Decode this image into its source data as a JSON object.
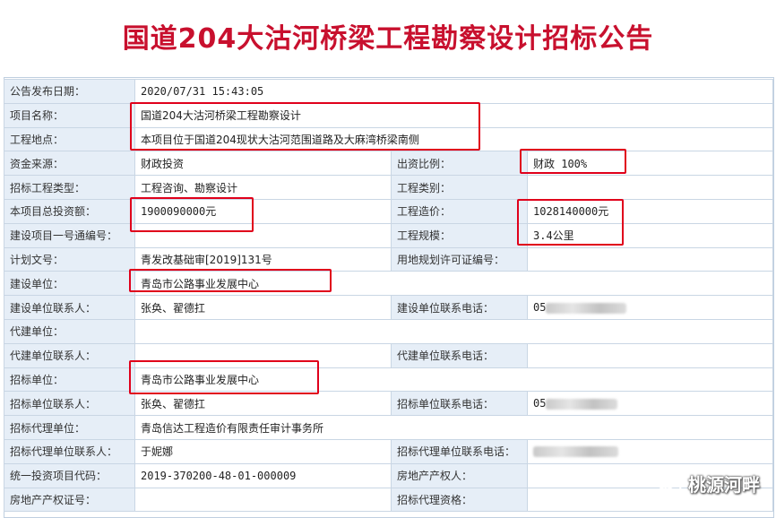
{
  "title": "国道204大沽河桥梁工程勘察设计招标公告",
  "rows": [
    {
      "l1": "公告发布日期：",
      "v1": "2020/07/31 15:43:05"
    },
    {
      "l1": "项目名称：",
      "v1": "国道204大沽河桥梁工程勘察设计"
    },
    {
      "l1": "工程地点：",
      "v1": "本项目位于国道204现状大沽河范围道路及大麻湾桥梁南侧"
    },
    {
      "l1": "资金来源：",
      "v1": "财政投资",
      "l2": "出资比例：",
      "v2": "财政 100%"
    },
    {
      "l1": "招标工程类型：",
      "v1": "工程咨询、勘察设计",
      "l2": "工程类别：",
      "v2": ""
    },
    {
      "l1": "本项目总投资额：",
      "v1": "1900090000元",
      "l2": "工程造价：",
      "v2": "1028140000元"
    },
    {
      "l1": "建设项目一号通编号：",
      "v1": "",
      "l2": "工程规模：",
      "v2": "3.4公里"
    },
    {
      "l1": "计划文号：",
      "v1": "青发改基础审[2019]131号",
      "l2": "用地规划许可证编号：",
      "v2": ""
    },
    {
      "l1": "建设单位：",
      "v1": "青岛市公路事业发展中心"
    },
    {
      "l1": "建设单位联系人：",
      "v1": "张奂、翟德扛",
      "l2": "建设单位联系电话：",
      "v2": "05"
    },
    {
      "l1": "代建单位：",
      "v1": ""
    },
    {
      "l1": "代建单位联系人：",
      "v1": "",
      "l2": "代建单位联系电话：",
      "v2": ""
    },
    {
      "l1": "招标单位：",
      "v1": "青岛市公路事业发展中心"
    },
    {
      "l1": "招标单位联系人：",
      "v1": "张奂、翟德扛",
      "l2": "招标单位联系电话：",
      "v2": "05"
    },
    {
      "l1": "招标代理单位：",
      "v1": "青岛信达工程造价有限责任审计事务所"
    },
    {
      "l1": "招标代理单位联系人：",
      "v1": "于妮娜",
      "l2": "招标代理单位联系电话：",
      "v2": ""
    },
    {
      "l1": "统一投资项目代码：",
      "v1": "2019-370200-48-01-000009",
      "l2": "房地产产权人：",
      "v2": ""
    },
    {
      "l1": "房地产产权证号：",
      "v1": "",
      "l2": "招标代理资格：",
      "v2": ""
    }
  ],
  "watermark": {
    "text": "桃源河畔",
    "icon": "wechat-icon"
  },
  "colors": {
    "title": "#c8102e",
    "label_bg": "#e6eef7",
    "highlight": "#e0001b",
    "border": "#c9d6e4"
  }
}
